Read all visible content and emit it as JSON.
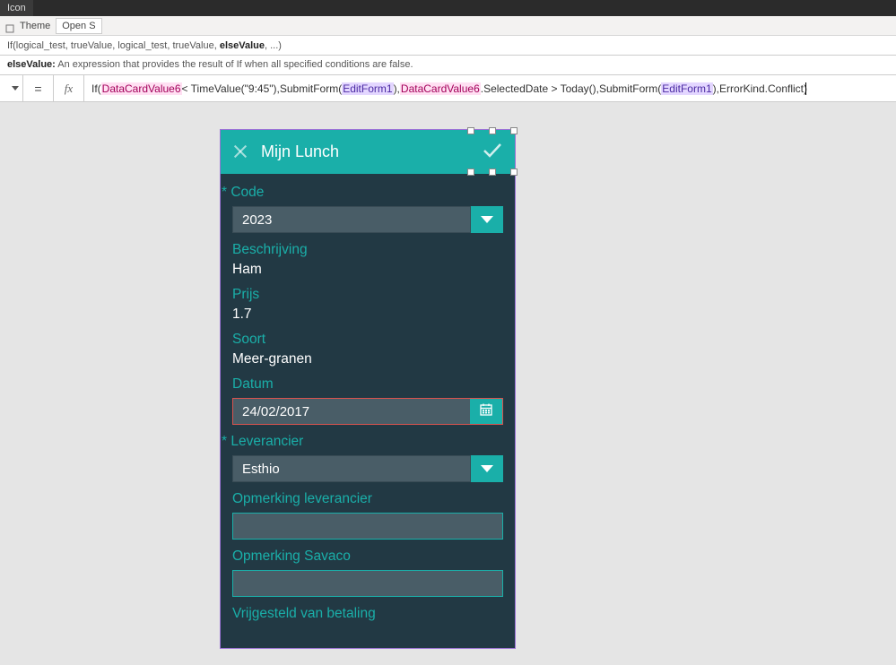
{
  "topbar": {
    "tab": "Icon"
  },
  "ribbon": {
    "theme": "Theme",
    "open": "Open S"
  },
  "hint1": {
    "prefix": "If(logical_test, trueValue, logical_test, trueValue, ",
    "bold": "elseValue",
    "suffix": ", ...)"
  },
  "hint2": {
    "bold": "elseValue:",
    "rest": " An expression that provides the result of If when all specified conditions are false."
  },
  "formula": {
    "p1": "If(",
    "t1": "DataCardValue6",
    "p2": " < TimeValue(\"9:45\"),SubmitForm(",
    "t2": "EditForm1",
    "p3": "),",
    "t3": "DataCardValue6",
    "p4": ".SelectedDate > Today(),SubmitForm(",
    "t4": "EditForm1",
    "p5": "),ErrorKind.Conflict)"
  },
  "header": {
    "title": "Mijn Lunch"
  },
  "form": {
    "code_label": "Code",
    "code_value": "2023",
    "desc_label": "Beschrijving",
    "desc_value": "Ham",
    "price_label": "Prijs",
    "price_value": "1.7",
    "kind_label": "Soort",
    "kind_value": "Meer-granen",
    "date_label": "Datum",
    "date_value": "24/02/2017",
    "supplier_label": "Leverancier",
    "supplier_value": "Esthio",
    "remark_supplier_label": "Opmerking leverancier",
    "remark_savaco_label": "Opmerking Savaco",
    "exempt_label": "Vrijgesteld van betaling"
  }
}
